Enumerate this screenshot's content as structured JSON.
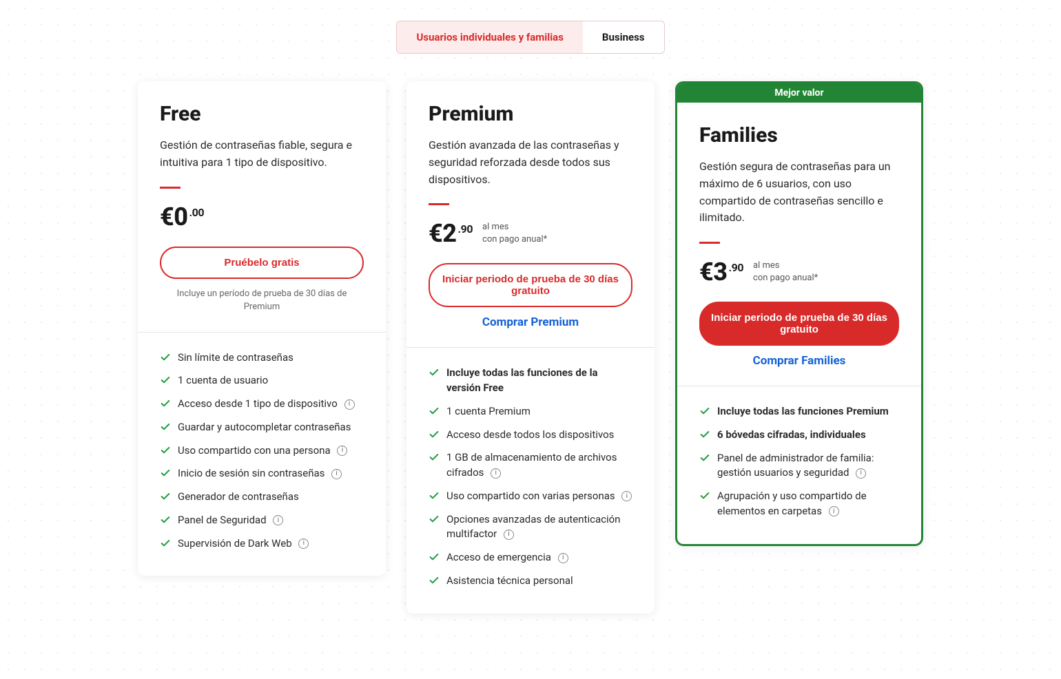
{
  "tabs": {
    "individual": "Usuarios individuales y familias",
    "business": "Business"
  },
  "best_value_badge": "Mejor valor",
  "plans": {
    "free": {
      "name": "Free",
      "desc": "Gestión de contraseñas fiable, segura e intuitiva para 1 tipo de dispositivo.",
      "currency": "€",
      "amount": "0",
      "cents": ".00",
      "sub1": "",
      "sub2": "",
      "cta": "Pruébelo gratis",
      "note": "Incluye un período de prueba de 30 días de Premium",
      "features": [
        {
          "text": "Sin límite de contraseñas",
          "info": false,
          "bold": false
        },
        {
          "text": "1 cuenta de usuario",
          "info": false,
          "bold": false
        },
        {
          "text": "Acceso desde 1 tipo de dispositivo",
          "info": true,
          "bold": false
        },
        {
          "text": "Guardar y autocompletar contraseñas",
          "info": false,
          "bold": false
        },
        {
          "text": "Uso compartido con una persona",
          "info": true,
          "bold": false
        },
        {
          "text": "Inicio de sesión sin contraseñas",
          "info": true,
          "bold": false
        },
        {
          "text": "Generador de contraseñas",
          "info": false,
          "bold": false
        },
        {
          "text": "Panel de Seguridad",
          "info": true,
          "bold": false
        },
        {
          "text": "Supervisión de Dark Web",
          "info": true,
          "bold": false
        }
      ]
    },
    "premium": {
      "name": "Premium",
      "desc": "Gestión avanzada de las contraseñas y seguridad reforzada desde todos sus dispositivos.",
      "currency": "€",
      "amount": "2",
      "cents": ".90",
      "sub1": "al mes",
      "sub2": "con pago anual*",
      "cta": "Iniciar periodo de prueba de 30 días gratuito",
      "buy": "Comprar Premium",
      "features": [
        {
          "text": "Incluye todas las funciones de la versión Free",
          "info": false,
          "bold": true
        },
        {
          "text": "1 cuenta Premium",
          "info": false,
          "bold": false
        },
        {
          "text": "Acceso desde todos los dispositivos",
          "info": false,
          "bold": false
        },
        {
          "text": "1 GB de almacenamiento de archivos cifrados",
          "info": true,
          "bold": false
        },
        {
          "text": "Uso compartido con varias personas",
          "info": true,
          "bold": false
        },
        {
          "text": "Opciones avanzadas de autenticación multifactor",
          "info": true,
          "bold": false
        },
        {
          "text": "Acceso de emergencia",
          "info": true,
          "bold": false
        },
        {
          "text": "Asistencia técnica personal",
          "info": false,
          "bold": false
        }
      ]
    },
    "families": {
      "name": "Families",
      "desc": "Gestión segura de contraseñas para un máximo de 6 usuarios, con uso compartido de contraseñas sencillo e ilimitado.",
      "currency": "€",
      "amount": "3",
      "cents": ".90",
      "sub1": "al mes",
      "sub2": "con pago anual*",
      "cta": "Iniciar periodo de prueba de 30 días gratuito",
      "buy": "Comprar Families",
      "features": [
        {
          "text": "Incluye todas las funciones Premium",
          "info": false,
          "bold": true
        },
        {
          "text": "6 bóvedas cifradas, individuales",
          "info": false,
          "bold": true
        },
        {
          "text": "Panel de administrador de familia: gestión usuarios y seguridad",
          "info": true,
          "bold": false
        },
        {
          "text": "Agrupación y uso compartido de elementos en carpetas",
          "info": true,
          "bold": false
        }
      ]
    }
  }
}
